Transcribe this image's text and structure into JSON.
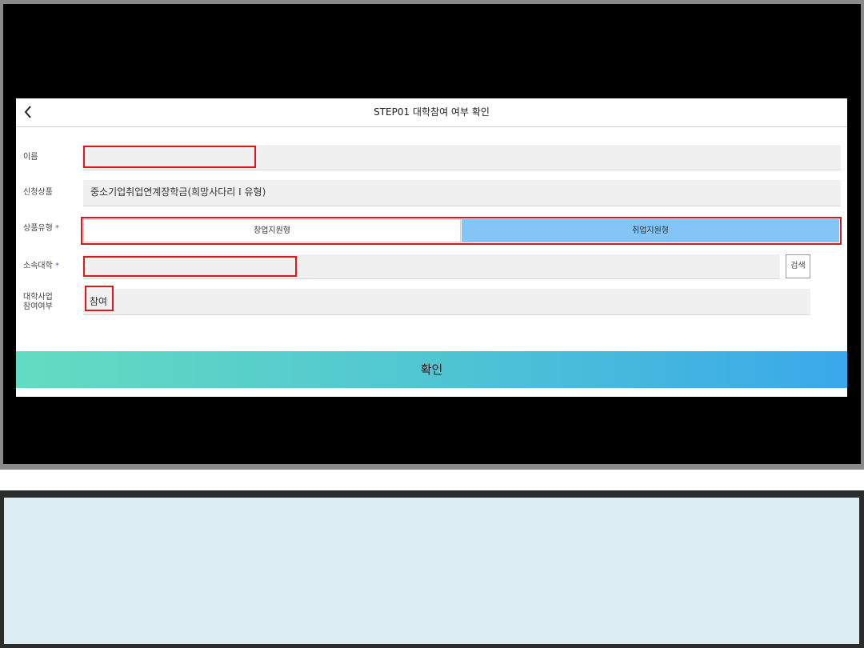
{
  "header": {
    "title": "STEP01 대학참여 여부 확인",
    "back_icon": "chevron-left-icon"
  },
  "form": {
    "name": {
      "label": "이름",
      "value": ""
    },
    "product": {
      "label": "신청상품",
      "value": "중소기업취업연계장학금(희망사다리 I 유형)"
    },
    "product_type": {
      "label": "상품유형",
      "required_mark": "*",
      "options": [
        "창업지원형",
        "취업지원형"
      ],
      "selected": "취업지원형"
    },
    "university": {
      "label": "소속대학",
      "required_mark": "*",
      "value": "",
      "search_label": "검색"
    },
    "participation": {
      "label_line1": "대학사업",
      "label_line2": "참여여부",
      "value": "참여"
    }
  },
  "confirm_label": "확인",
  "colors": {
    "highlight": "#e0161b",
    "selected_segment": "#84c5f7",
    "confirm_gradient_start": "#62dcc0",
    "confirm_gradient_end": "#3aa8ea",
    "bottom_panel": "#dbedf3"
  }
}
